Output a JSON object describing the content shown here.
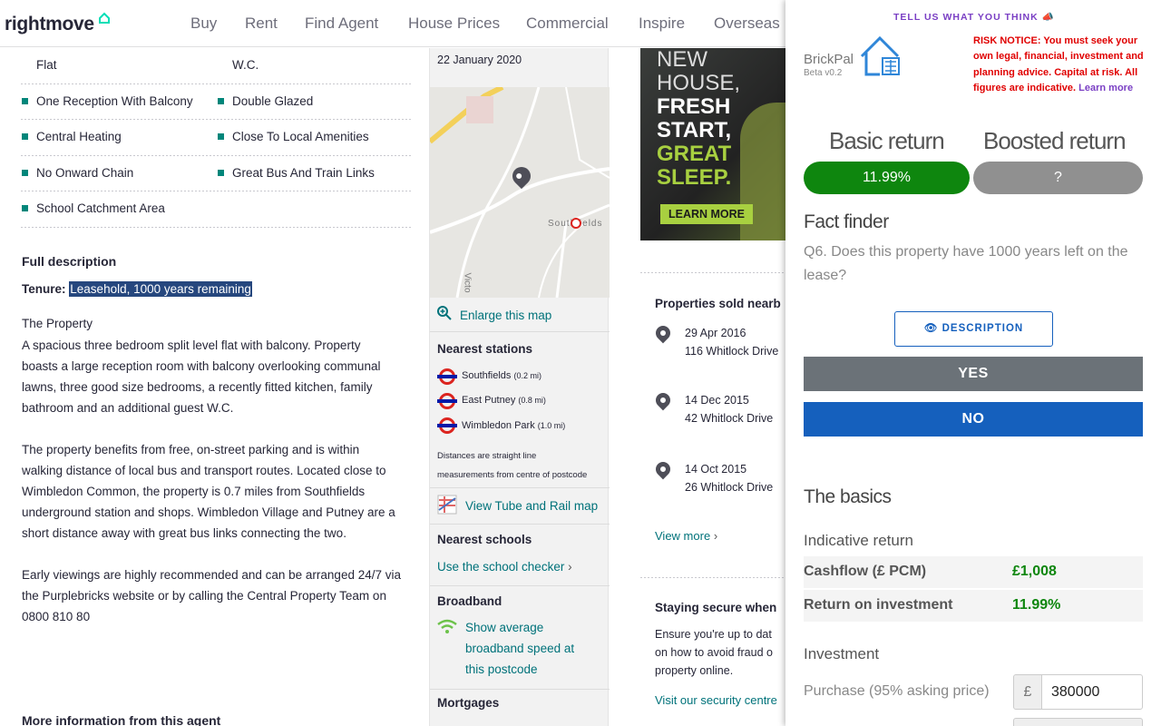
{
  "header": {
    "logo": "rightmove",
    "nav": [
      "Buy",
      "Rent",
      "Find Agent",
      "House Prices",
      "Commercial",
      "Inspire",
      "Overseas"
    ]
  },
  "features": [
    [
      "Flat",
      "W.C."
    ],
    [
      "One Reception With Balcony",
      "Double Glazed"
    ],
    [
      "Central Heating",
      "Close To Local Amenities"
    ],
    [
      "No Onward Chain",
      "Great Bus And Train Links"
    ],
    [
      "School Catchment Area",
      ""
    ]
  ],
  "description": {
    "heading": "Full description",
    "tenure_label": "Tenure:",
    "tenure_value": "Leasehold, 1000 years remaining",
    "property_heading": "The Property",
    "paragraphs": [
      [
        "A spacious three bedroom split level flat with balcony. Property",
        "boasts a large reception room with balcony overlooking communal",
        "lawns, three good size bedrooms, a recently fitted kitchen, family",
        "bathroom and an additional guest W.C."
      ],
      [
        "The property benefits from free, on-street parking and is within",
        "walking distance of local bus and transport routes. Located close to",
        "Wimbledon Common, the property is 0.7 miles from Southfields",
        "underground station and shops. Wimbledon Village and Putney are a",
        "short distance away with great bus links connecting the two."
      ],
      [
        "Early viewings are highly recommended and can be arranged 24/7 via",
        "the Purplebricks website or by calling the Central Property Team on",
        "0800 810 80"
      ]
    ],
    "more_info": "More information from this agent"
  },
  "sidebar": {
    "date": "22 January 2020",
    "map_label_station": "Southfields",
    "map_label_road": "Victo",
    "enlarge_map": "Enlarge this map",
    "stations_heading": "Nearest stations",
    "stations": [
      {
        "name": "Southfields",
        "dist": "(0.2 mi)"
      },
      {
        "name": "East Putney",
        "dist": "(0.8 mi)"
      },
      {
        "name": "Wimbledon Park",
        "dist": "(1.0 mi)"
      }
    ],
    "distance_note_1": "Distances are straight line",
    "distance_note_2": "measurements from centre of postcode",
    "tube_map_link": "View Tube and Rail map",
    "schools_heading": "Nearest schools",
    "school_checker": "Use the school checker",
    "broadband_heading": "Broadband",
    "broadband_link_1": "Show average",
    "broadband_link_2": "broadband speed at",
    "broadband_link_3": "this postcode",
    "mortgages_heading": "Mortgages"
  },
  "right": {
    "ad_lines": [
      "NEW",
      "HOUSE,",
      "FRESH",
      "START,",
      "GREAT",
      "SLEEP."
    ],
    "ad_cta": "LEARN MORE",
    "sold_heading": "Properties sold nearb",
    "sold": [
      {
        "date": "29 Apr 2016",
        "addr": "116 Whitlock Drive"
      },
      {
        "date": "14 Dec 2015",
        "addr": "42 Whitlock Drive"
      },
      {
        "date": "14 Oct 2015",
        "addr": "26 Whitlock Drive"
      }
    ],
    "view_more": "View more",
    "secure_heading": "Staying secure when",
    "secure_text": [
      "Ensure you're up to dat",
      "on how to avoid fraud o",
      "property online."
    ],
    "security_link": "Visit our security centre"
  },
  "panel": {
    "feedback": "TELL US WHAT YOU THINK",
    "brand": "BrickPal",
    "version": "Beta v0.2",
    "risk_prefix": "RISK NOTICE: You must seek your own legal, financial, investment and planning advice. Capital at risk. All figures are indicative.",
    "learn_more": "Learn more",
    "basic_label": "Basic return",
    "boosted_label": "Boosted return",
    "basic_value": "11.99%",
    "boosted_value": "?",
    "fact_finder": "Fact finder",
    "question": "Q6. Does this property have 1000 years left on the lease?",
    "description_btn": "DESCRIPTION",
    "yes": "YES",
    "no": "NO",
    "basics": "The basics",
    "indicative": "Indicative return",
    "cashflow_label": "Cashflow (£ PCM)",
    "cashflow_value": "£1,008",
    "roi_label": "Return on investment",
    "roi_value": "11.99%",
    "investment": "Investment",
    "purchase_label": "Purchase (95% asking price)",
    "currency": "£",
    "purchase_value": "380000"
  },
  "colors": {
    "accent_green": "#0e860e",
    "accent_blue": "#1560bd",
    "teal": "#00867a",
    "rightmove_link": "#00727a",
    "risk_red": "#e00000"
  }
}
